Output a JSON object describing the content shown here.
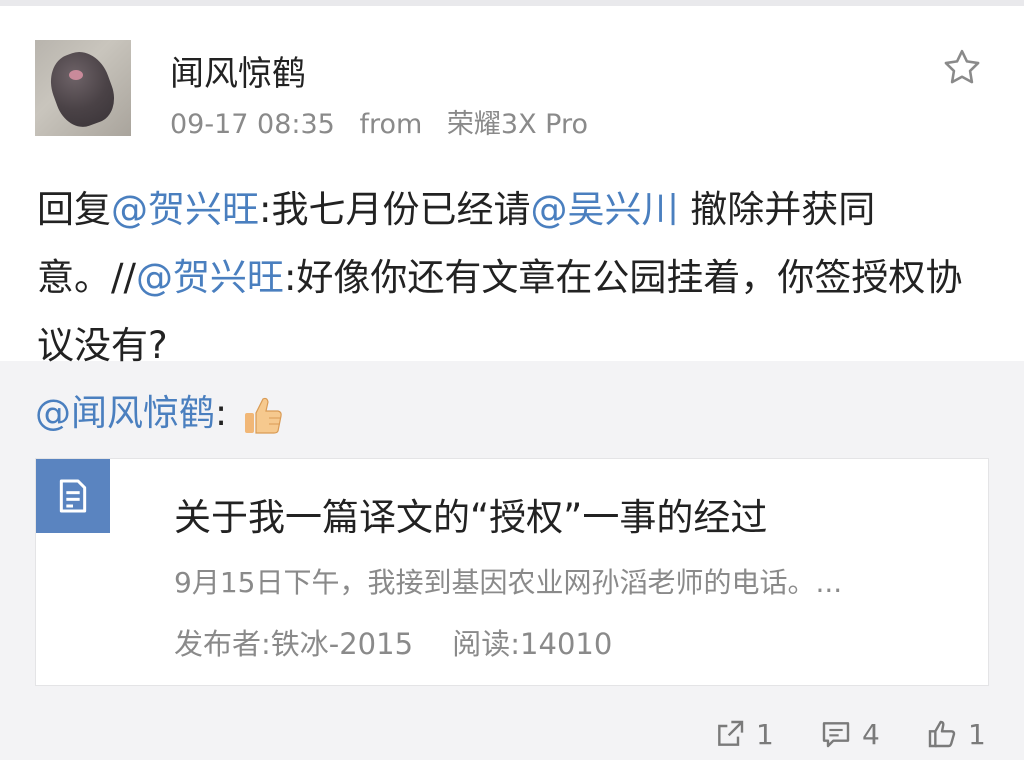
{
  "post": {
    "username": "闻风惊鹤",
    "date": "09-17 08:35",
    "from_label": "from",
    "device": "荣耀3X Pro",
    "content": {
      "prefix": "回复",
      "mention1": "@贺兴旺",
      "text1": ":我七月份已经请",
      "mention2": "@吴兴川",
      "text2": " 撤除并获同意。//",
      "mention3": "@贺兴旺",
      "text3": ":好像你还有文章在公园挂着，你签授权协议没有?"
    }
  },
  "repost": {
    "mention": "@闻风惊鹤",
    "colon": ":"
  },
  "card": {
    "title": "关于我一篇译文的“授权”一事的经过",
    "summary": "9月15日下午，我接到基因农业网孙滔老师的电话。...",
    "publisher": "发布者:铁冰-2015",
    "reads": "阅读:14010"
  },
  "actions": {
    "share_count": "1",
    "comment_count": "4",
    "like_count": "1"
  },
  "icons": {
    "favorite": "star-icon",
    "reaction": "thumbs-up-emoji",
    "card": "document-icon",
    "share": "share-icon",
    "comment": "comment-icon",
    "like": "like-icon"
  },
  "colors": {
    "mention": "#4a7fbf",
    "card_icon_bg": "#5a84c0",
    "meta_text": "#8a8a8a"
  }
}
